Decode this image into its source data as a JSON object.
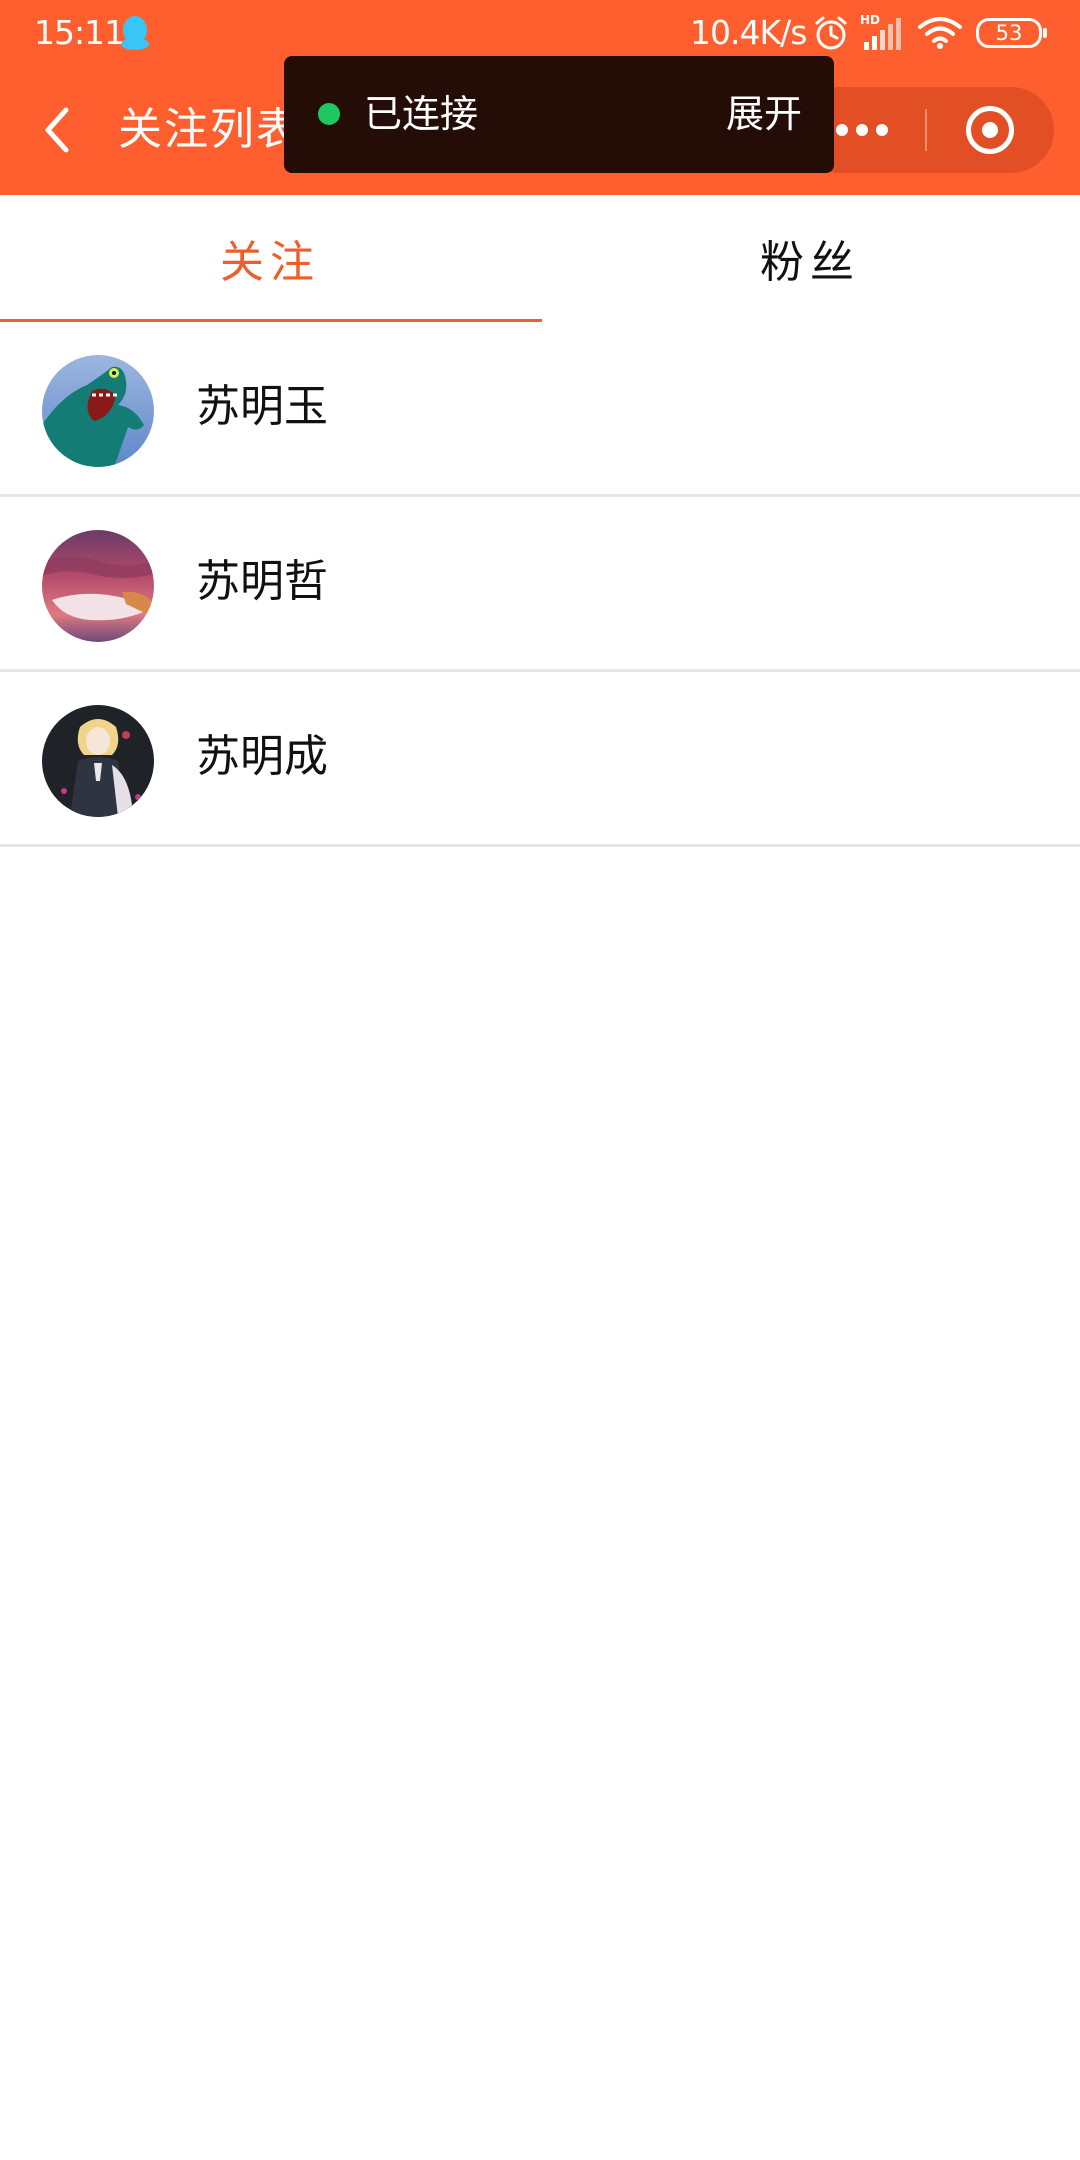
{
  "status_bar": {
    "time": "15:11",
    "net_speed": "10.4K/s",
    "battery": "53",
    "icons": [
      "qq-icon",
      "alarm-icon",
      "hd-signal-icon",
      "wifi-icon",
      "battery-icon"
    ]
  },
  "nav": {
    "title": "关注列表",
    "back_icon": "chevron-left-icon",
    "more_icon": "more-dots-icon",
    "close_icon": "target-close-icon"
  },
  "toast": {
    "status": "已连接",
    "expand_label": "展开",
    "status_color": "#1ec760"
  },
  "tabs": [
    {
      "label": "关注",
      "active": true
    },
    {
      "label": "粉丝",
      "active": false
    }
  ],
  "list": [
    {
      "name": "苏明玉"
    },
    {
      "name": "苏明哲"
    },
    {
      "name": "苏明成"
    }
  ],
  "colors": {
    "header": "#ff5f2e",
    "accent": "#ee5e2a",
    "toast_bg": "#230d06",
    "divider": "#e6e6e6"
  }
}
